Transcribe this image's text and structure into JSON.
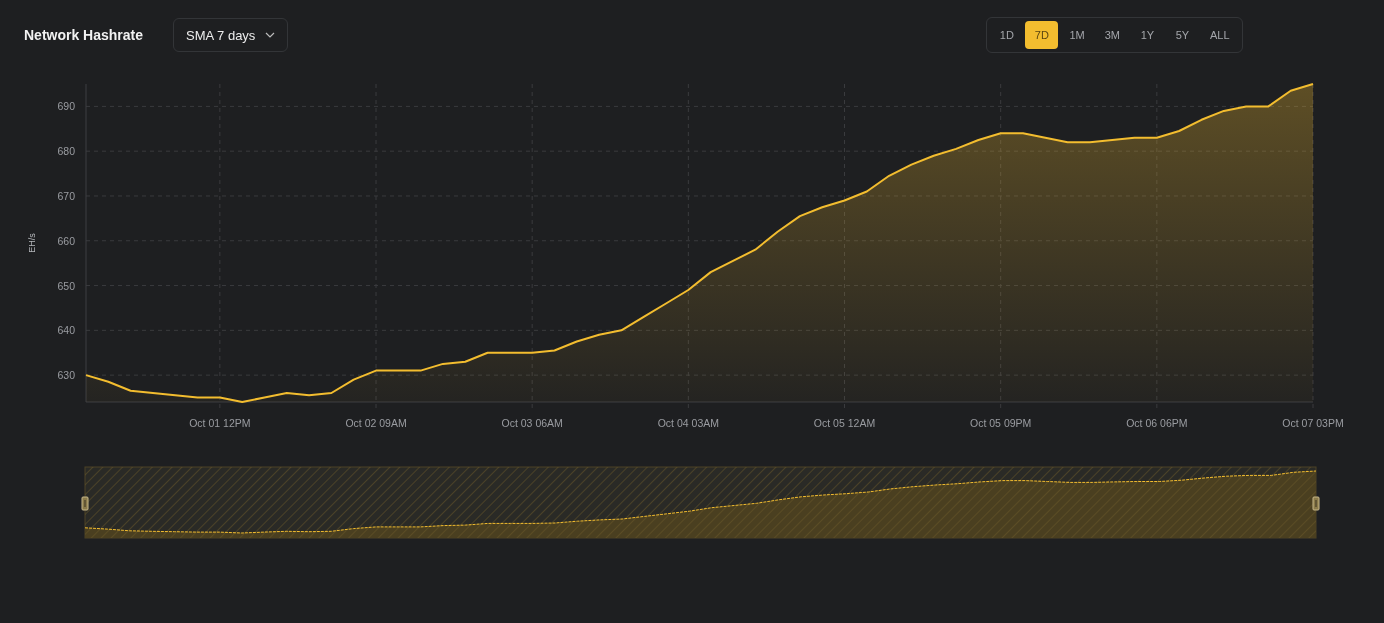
{
  "title": "Network Hashrate",
  "average_select": {
    "value": "SMA 7 days"
  },
  "range_tabs": [
    {
      "label": "1D",
      "selected": false
    },
    {
      "label": "7D",
      "selected": true
    },
    {
      "label": "1M",
      "selected": false
    },
    {
      "label": "3M",
      "selected": false
    },
    {
      "label": "1Y",
      "selected": false
    },
    {
      "label": "5Y",
      "selected": false
    },
    {
      "label": "ALL",
      "selected": false
    }
  ],
  "chart": {
    "chart_data": {
      "type": "area",
      "grid": true,
      "ylabel": "EH/s",
      "ylim": [
        624,
        695
      ],
      "yticks": [
        630,
        640,
        650,
        660,
        670,
        680,
        690
      ],
      "categories": [
        null,
        null,
        null,
        null,
        null,
        null,
        "Oct 01 12PM",
        null,
        null,
        null,
        null,
        null,
        null,
        "Oct 02 09AM",
        null,
        null,
        null,
        null,
        null,
        null,
        "Oct 03 06AM",
        null,
        null,
        null,
        null,
        null,
        null,
        "Oct 04 03AM",
        null,
        null,
        null,
        null,
        null,
        null,
        "Oct 05 12AM",
        null,
        null,
        null,
        null,
        null,
        null,
        "Oct 05 09PM",
        null,
        null,
        null,
        null,
        null,
        null,
        "Oct 06 06PM",
        null,
        null,
        null,
        null,
        null,
        null,
        "Oct 07 03PM"
      ],
      "series": [
        {
          "color": "#f3bd2f",
          "values": [
            630,
            628.5,
            626.5,
            626,
            625.5,
            625,
            625,
            624,
            625,
            626,
            625.5,
            626,
            629,
            631,
            631,
            631,
            632.5,
            633,
            635,
            635,
            635,
            635.5,
            637.5,
            639,
            640,
            643,
            646,
            649,
            653,
            655.5,
            658,
            662,
            665.5,
            667.5,
            669,
            671,
            674.5,
            677,
            679,
            680.5,
            682.5,
            684,
            684,
            683,
            682,
            682,
            682.5,
            683,
            683,
            684.5,
            687,
            689,
            690,
            690,
            693.5,
            695
          ]
        }
      ]
    }
  }
}
